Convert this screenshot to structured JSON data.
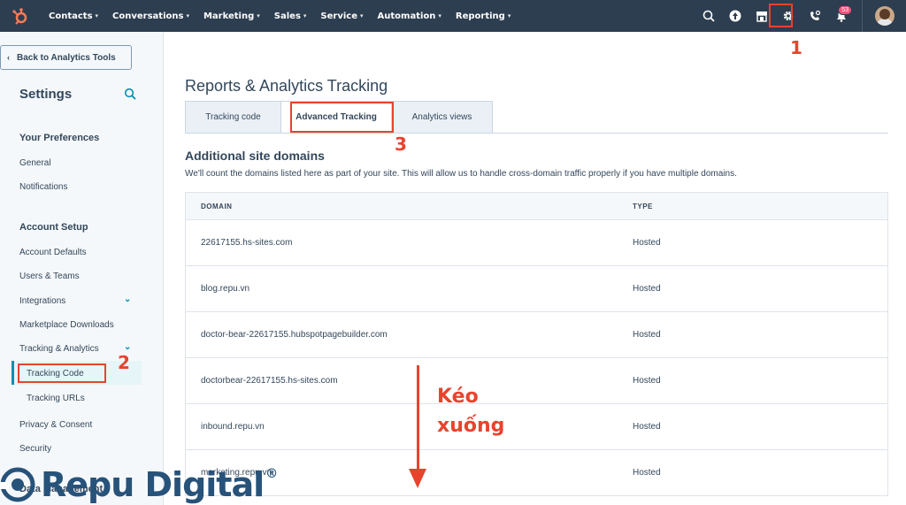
{
  "topnav": {
    "menu": [
      {
        "label": "Contacts"
      },
      {
        "label": "Conversations"
      },
      {
        "label": "Marketing"
      },
      {
        "label": "Sales"
      },
      {
        "label": "Service"
      },
      {
        "label": "Automation"
      },
      {
        "label": "Reporting"
      }
    ],
    "notification_count": "53"
  },
  "sidebar": {
    "back_label": "Back to Analytics Tools",
    "title": "Settings",
    "sections": {
      "preferences": "Your Preferences",
      "account_setup": "Account Setup",
      "data_management": "Data Management"
    },
    "items": {
      "general": "General",
      "notifications": "Notifications",
      "account_defaults": "Account Defaults",
      "users_teams": "Users & Teams",
      "integrations": "Integrations",
      "marketplace": "Marketplace Downloads",
      "tracking_analytics": "Tracking & Analytics",
      "tracking_code": "Tracking Code",
      "tracking_urls": "Tracking URLs",
      "privacy": "Privacy & Consent",
      "security": "Security"
    }
  },
  "main": {
    "title": "Reports & Analytics Tracking",
    "tabs": [
      {
        "label": "Tracking code"
      },
      {
        "label": "Advanced Tracking"
      },
      {
        "label": "Analytics views"
      }
    ],
    "section_title": "Additional site domains",
    "section_desc": "We'll count the domains listed here as part of your site. This will allow us to handle cross-domain traffic properly if you have multiple domains.",
    "table": {
      "headers": [
        "DOMAIN",
        "TYPE"
      ],
      "rows": [
        {
          "domain": "22617155.hs-sites.com",
          "type": "Hosted"
        },
        {
          "domain": "blog.repu.vn",
          "type": "Hosted"
        },
        {
          "domain": "doctor-bear-22617155.hubspotpagebuilder.com",
          "type": "Hosted"
        },
        {
          "domain": "doctorbear-22617155.hs-sites.com",
          "type": "Hosted"
        },
        {
          "domain": "inbound.repu.vn",
          "type": "Hosted"
        },
        {
          "domain": "marketing.repu.vn",
          "type": "Hosted"
        }
      ]
    }
  },
  "annotations": {
    "step1": "1",
    "step2": "2",
    "step3": "3",
    "drag_line1": "Kéo",
    "drag_line2": "xuống",
    "color": "#e8432e"
  },
  "watermark": {
    "text": "Repu Digital",
    "mark": "®"
  },
  "colors": {
    "nav_bg": "#2d3e50",
    "accent_teal": "#0091ae",
    "hubspot_orange": "#ff7a59",
    "annotation_red": "#e8432e"
  }
}
